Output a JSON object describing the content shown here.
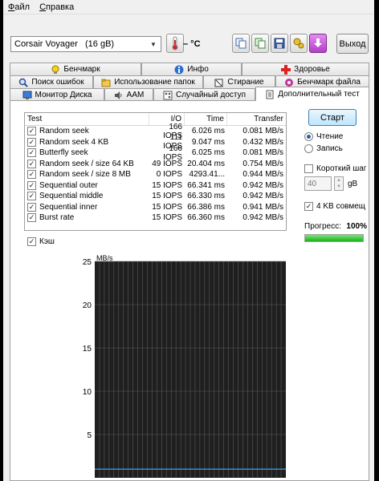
{
  "menu": [
    "Файл",
    "Справка"
  ],
  "device": {
    "name": "Corsair Voyager",
    "size": "(16 gB)"
  },
  "temperature": "– °C",
  "exit_label": "Выход",
  "tabs_row1": [
    "Бенчмарк",
    "Инфо",
    "Здоровье"
  ],
  "tabs_row2": [
    "Поиск ошибок",
    "Использование папок",
    "Стирание",
    "Бенчмарк файла"
  ],
  "tabs_row3": [
    "Монитор Диска",
    "AAM",
    "Случайный доступ",
    "Дополнительный тест"
  ],
  "results": {
    "headers": [
      "Test",
      "I/O",
      "Time",
      "Transfer"
    ],
    "rows": [
      {
        "test": "Random seek",
        "io": "166 IOPS",
        "time": "6.026 ms",
        "transfer": "0.081 MB/s"
      },
      {
        "test": "Random seek 4 KB",
        "io": "111 IOPS",
        "time": "9.047 ms",
        "transfer": "0.432 MB/s"
      },
      {
        "test": "Butterfly seek",
        "io": "166 IOPS",
        "time": "6.025 ms",
        "transfer": "0.081 MB/s"
      },
      {
        "test": "Random seek / size 64 KB",
        "io": "49 IOPS",
        "time": "20.404 ms",
        "transfer": "0.754 MB/s"
      },
      {
        "test": "Random seek / size 8 MB",
        "io": "0 IOPS",
        "time": "4293.41...",
        "transfer": "0.944 MB/s"
      },
      {
        "test": "Sequential outer",
        "io": "15 IOPS",
        "time": "66.341 ms",
        "transfer": "0.942 MB/s"
      },
      {
        "test": "Sequential middle",
        "io": "15 IOPS",
        "time": "66.330 ms",
        "transfer": "0.942 MB/s"
      },
      {
        "test": "Sequential inner",
        "io": "15 IOPS",
        "time": "66.386 ms",
        "transfer": "0.941 MB/s"
      },
      {
        "test": "Burst rate",
        "io": "15 IOPS",
        "time": "66.360 ms",
        "transfer": "0.942 MB/s"
      }
    ]
  },
  "controls": {
    "start_label": "Старт",
    "read_label": "Чтение",
    "write_label": "Запись",
    "short_step_label": "Короткий шаг",
    "step_value": "40",
    "step_unit": "gB",
    "align_label": "4 KB совмещ",
    "progress_label": "Прогресс:",
    "progress_value": "100%",
    "progress_fraction": 1.0
  },
  "cache_label": "Кэш",
  "colors": {
    "chart_bg": "#1f1f1f",
    "grid": "#5a5a5a",
    "line": "#2f8fd6",
    "progress": "#19b419"
  },
  "chart_data": {
    "type": "line",
    "ylabel": "MB/s",
    "ylim": [
      0,
      25
    ],
    "yticks": [
      5,
      10,
      15,
      20,
      25
    ],
    "series": [
      {
        "values": [
          1.0,
          1.0,
          1.0,
          1.0,
          1.0,
          1.0,
          1.0,
          1.0,
          1.0,
          1.0,
          1.0
        ]
      }
    ],
    "grid": true
  }
}
